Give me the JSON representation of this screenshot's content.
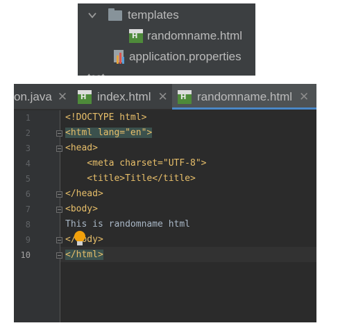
{
  "project_tree": {
    "templates_folder": "templates",
    "file_randomname": "randomname.html",
    "file_properties": "application.properties",
    "cut_folder": "test"
  },
  "tabs": [
    {
      "label": "on.java",
      "active": false
    },
    {
      "label": "index.html",
      "active": false
    },
    {
      "label": "randomname.html",
      "active": true
    }
  ],
  "editor": {
    "current_line": 10,
    "line_numbers": [
      "1",
      "2",
      "3",
      "4",
      "5",
      "6",
      "7",
      "8",
      "9",
      "10"
    ],
    "lines": [
      "<!DOCTYPE html>",
      "<html lang=\"en\">",
      "<head>",
      "    <meta charset=\"UTF-8\">",
      "    <title>Title</title>",
      "</head>",
      "<body>",
      "This is randomname html",
      "</body>",
      "</html>"
    ]
  },
  "colors": {
    "editor_bg": "#2b2b2b",
    "tag": "#e8bf6a",
    "string": "#6a8759",
    "text": "#a9b7c6",
    "tab_accent": "#4a88c7"
  }
}
